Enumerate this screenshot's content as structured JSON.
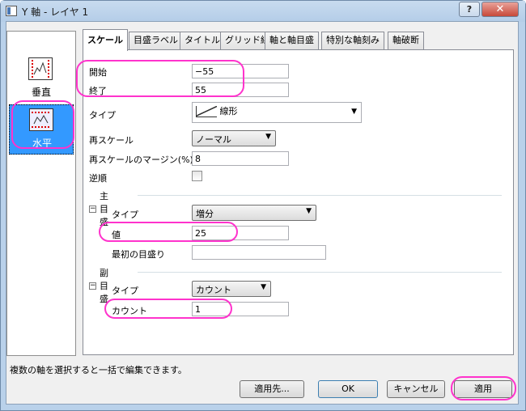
{
  "window": {
    "title": "Y 軸 - レイヤ 1",
    "help": "?",
    "close": "✕"
  },
  "left_panel": {
    "items": [
      {
        "label": "垂直"
      },
      {
        "label": "水平"
      }
    ]
  },
  "tabs": [
    "スケール",
    "目盛ラベル",
    "タイトル",
    "グリッド線",
    "軸と軸目盛",
    "特別な軸刻み",
    "軸破断"
  ],
  "scale": {
    "start_label": "開始",
    "start_value": "−55",
    "end_label": "終了",
    "end_value": "55",
    "type_label": "タイプ",
    "type_value": "線形",
    "rescale_label": "再スケール",
    "rescale_value": "ノーマル",
    "margin_label": "再スケールのマージン(%)",
    "margin_value": "8",
    "reverse_label": "逆順"
  },
  "major": {
    "header": "主目盛",
    "toggle": "−",
    "type_label": "タイプ",
    "type_value": "増分",
    "value_label": "値",
    "value_value": "25",
    "first_label": "最初の目盛り",
    "first_value": ""
  },
  "minor": {
    "header": "副目盛",
    "toggle": "−",
    "type_label": "タイプ",
    "type_value": "カウント",
    "count_label": "カウント",
    "count_value": "1"
  },
  "status": "複数の軸を選択すると一括で編集できます。",
  "buttons": {
    "apply_to": "適用先...",
    "ok": "OK",
    "cancel": "キャンセル",
    "apply": "適用"
  },
  "colors": {
    "highlight": "#ff33cc",
    "selection": "#3399ff"
  }
}
